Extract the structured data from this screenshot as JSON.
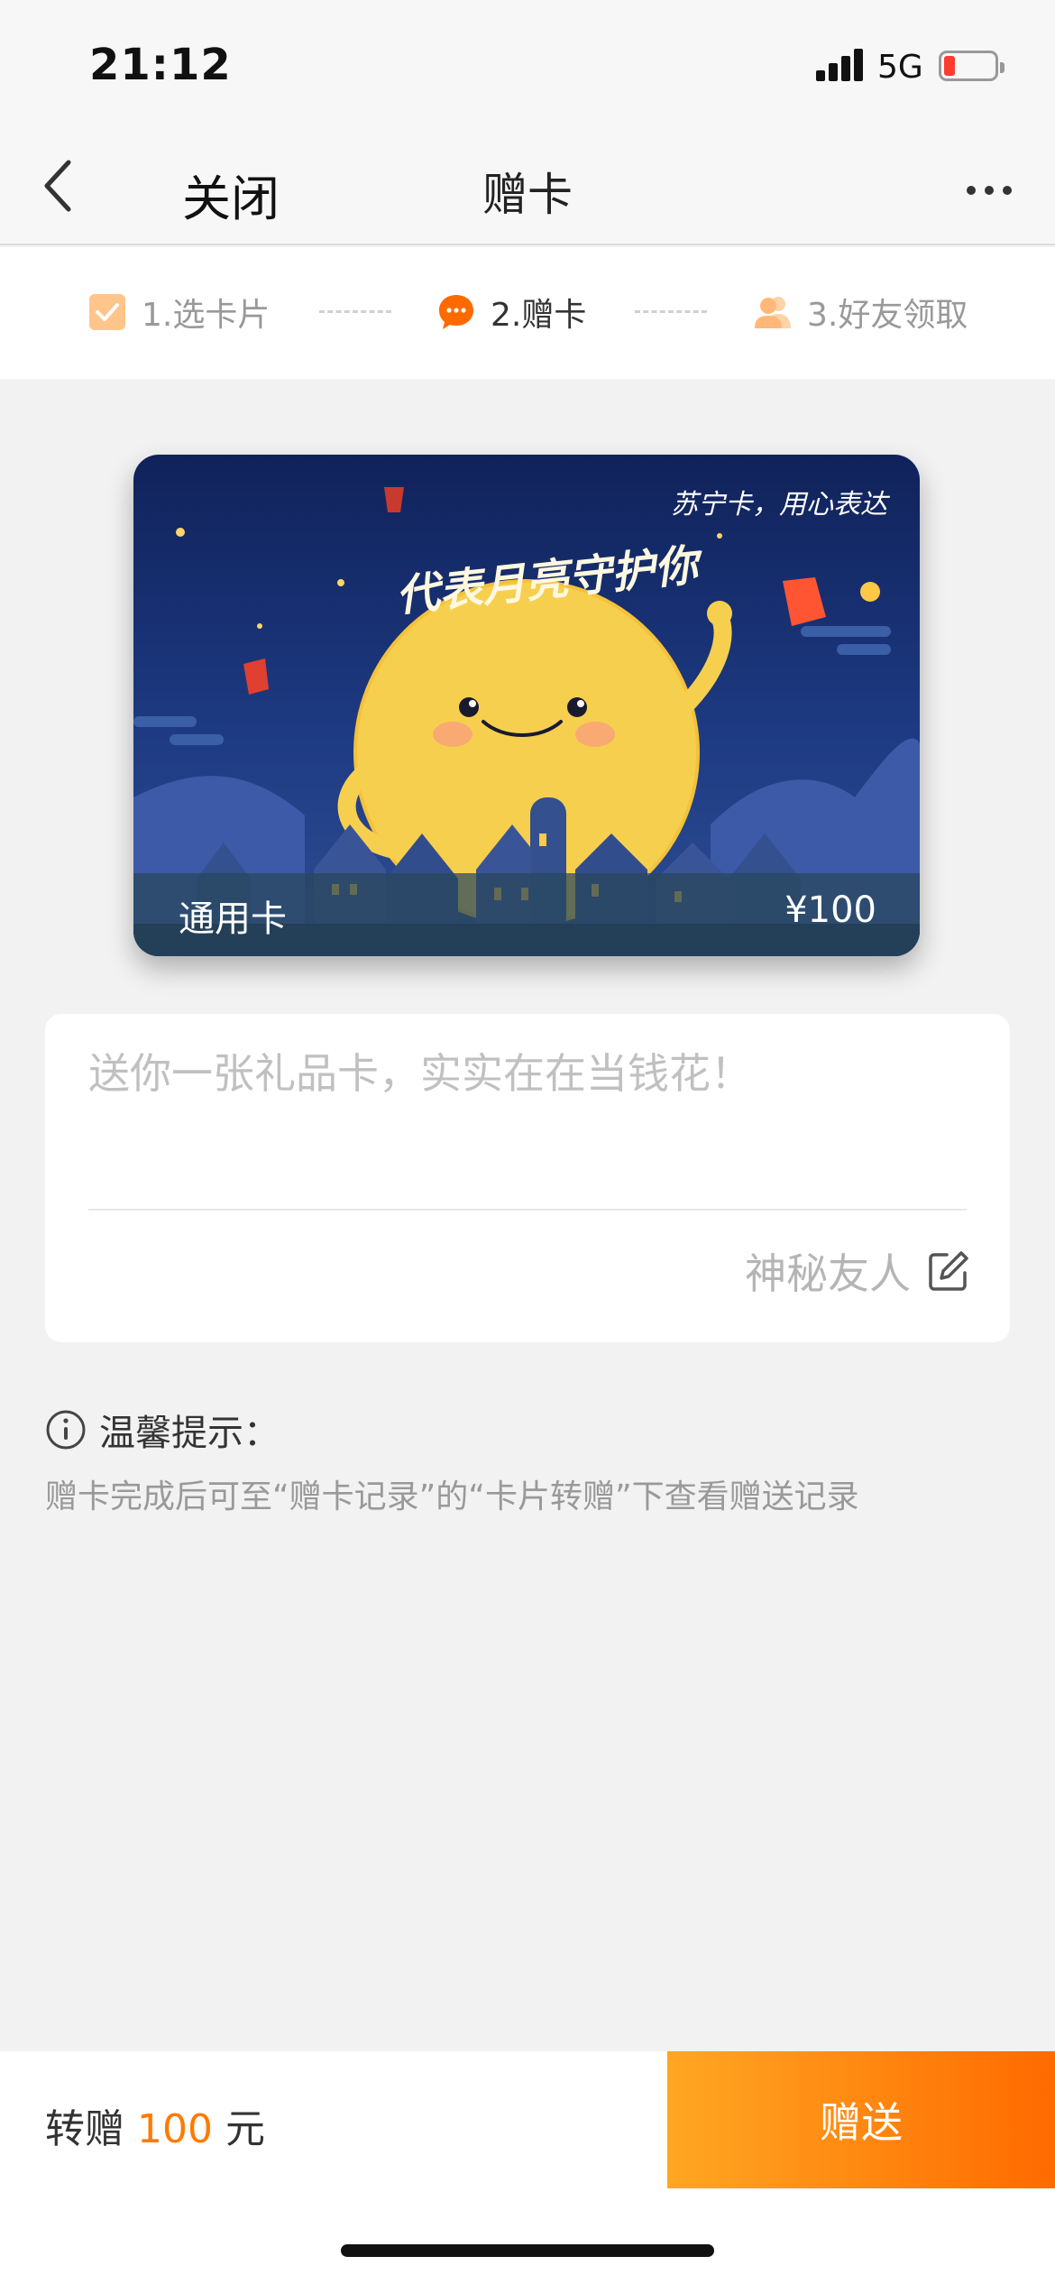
{
  "status_bar": {
    "time": "21:12",
    "network": "5G",
    "icons": [
      "signal-icon",
      "battery-icon"
    ]
  },
  "nav": {
    "close_label": "关闭",
    "title": "赠卡",
    "icons": [
      "back-icon",
      "more-icon"
    ]
  },
  "steps": [
    {
      "label": "1.选卡片",
      "icon": "checkbox-icon",
      "state": "done"
    },
    {
      "label": "2.赠卡",
      "icon": "chat-icon",
      "state": "current"
    },
    {
      "label": "3.好友领取",
      "icon": "friends-icon",
      "state": "pending"
    }
  ],
  "card": {
    "slogan": "苏宁卡，用心表达",
    "title": "代表月亮守护你",
    "type": "通用卡",
    "amount": "¥100"
  },
  "message": {
    "text": "送你一张礼品卡，实实在在当钱花！",
    "sender": "神秘友人",
    "icons": [
      "edit-icon"
    ]
  },
  "tips": {
    "title": "温馨提示：",
    "body": "赠卡完成后可至“赠卡记录”的“卡片转赠”下查看赠送记录",
    "icons": [
      "info-icon"
    ]
  },
  "footer": {
    "prefix": "转赠",
    "amount": "100",
    "unit": "元",
    "send_label": "赠送"
  },
  "colors": {
    "accent": "#ff7a00",
    "button_start": "#ffa722",
    "button_end": "#ff6a00",
    "background": "#f2f2f2"
  }
}
